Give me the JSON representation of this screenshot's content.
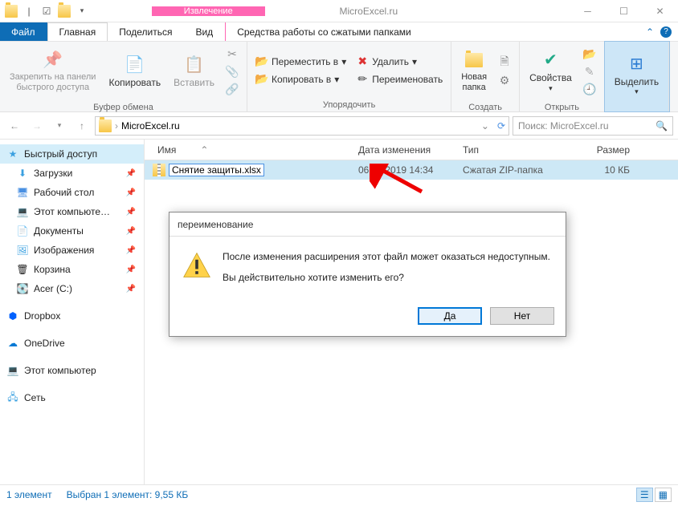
{
  "titlebar": {
    "context_label": "Извлечение",
    "title": "MicroExcel.ru"
  },
  "tabs": {
    "file": "Файл",
    "home": "Главная",
    "share": "Поделиться",
    "view": "Вид",
    "archive_tools": "Средства работы со сжатыми папками"
  },
  "ribbon": {
    "pin": "Закрепить на панели\nбыстрого доступа",
    "copy": "Копировать",
    "paste": "Вставить",
    "clipboard": "Буфер обмена",
    "move_to": "Переместить в",
    "copy_to": "Копировать в",
    "delete": "Удалить",
    "rename": "Переименовать",
    "organize": "Упорядочить",
    "new_folder": "Новая\nпапка",
    "create": "Создать",
    "properties": "Свойства",
    "open": "Открыть",
    "select": "Выделить"
  },
  "nav": {
    "breadcrumb": "MicroExcel.ru",
    "search_placeholder": "Поиск: MicroExcel.ru"
  },
  "columns": {
    "name": "Имя",
    "date": "Дата изменения",
    "type": "Тип",
    "size": "Размер"
  },
  "file": {
    "name": "Снятие защиты.xlsx",
    "date": "06.12.2019 14:34",
    "type": "Сжатая ZIP-папка",
    "size": "10 КБ"
  },
  "navpane": {
    "quick": "Быстрый доступ",
    "downloads": "Загрузки",
    "desktop": "Рабочий стол",
    "this_pc_folder": "Этот компьюте…",
    "documents": "Документы",
    "pictures": "Изображения",
    "recycle": "Корзина",
    "acer": "Acer (C:)",
    "dropbox": "Dropbox",
    "onedrive": "OneDrive",
    "this_pc": "Этот компьютер",
    "network": "Сеть"
  },
  "dialog": {
    "title": "переименование",
    "line1": "После изменения расширения этот файл может оказаться недоступным.",
    "line2": "Вы действительно хотите изменить его?",
    "yes": "Да",
    "no": "Нет"
  },
  "status": {
    "count": "1 элемент",
    "selected": "Выбран 1 элемент: 9,55 КБ"
  }
}
